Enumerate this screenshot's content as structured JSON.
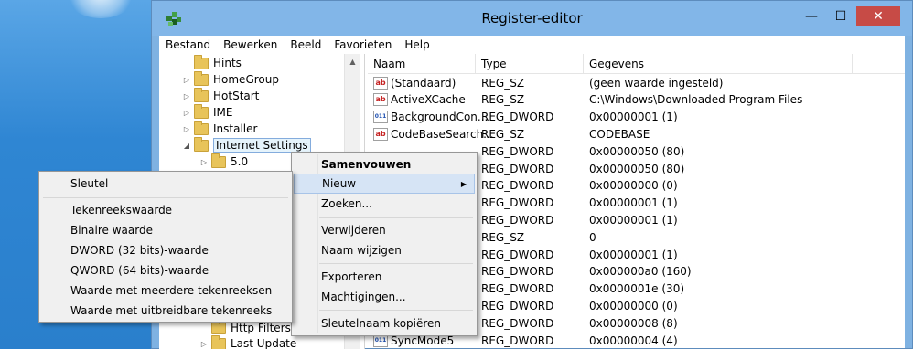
{
  "window": {
    "title": "Register-editor",
    "controls": {
      "minimize": "—",
      "maximize": "☐",
      "close": "✕"
    }
  },
  "menubar": [
    "Bestand",
    "Bewerken",
    "Beeld",
    "Favorieten",
    "Help"
  ],
  "tree": {
    "items": [
      {
        "label": "Hints",
        "expander": ""
      },
      {
        "label": "HomeGroup",
        "expander": "▷"
      },
      {
        "label": "HotStart",
        "expander": "▷"
      },
      {
        "label": "IME",
        "expander": "▷"
      },
      {
        "label": "Installer",
        "expander": "▷"
      },
      {
        "label": "Internet Settings",
        "expander": "◢",
        "selected": true
      },
      {
        "label": "5.0",
        "expander": "▷"
      },
      {
        "label": "Http Filters",
        "expander": ""
      },
      {
        "label": "Last Update",
        "expander": "▷"
      }
    ]
  },
  "list": {
    "columns": [
      "Naam",
      "Type",
      "Gegevens"
    ],
    "rows": [
      {
        "name": "(Standaard)",
        "type": "REG_SZ",
        "data": "(geen waarde ingesteld)",
        "icon": "string-value-icon"
      },
      {
        "name": "ActiveXCache",
        "type": "REG_SZ",
        "data": "C:\\Windows\\Downloaded Program Files",
        "icon": "string-value-icon"
      },
      {
        "name": "BackgroundCon...",
        "type": "REG_DWORD",
        "data": "0x00000001 (1)",
        "icon": "dword-value-icon"
      },
      {
        "name": "CodeBaseSearch...",
        "type": "REG_SZ",
        "data": "CODEBASE",
        "icon": "string-value-icon"
      },
      {
        "name": "",
        "type": "REG_DWORD",
        "data": "0x00000050 (80)",
        "icon": ""
      },
      {
        "name": "",
        "type": "REG_DWORD",
        "data": "0x00000050 (80)",
        "icon": ""
      },
      {
        "name": "",
        "type": "REG_DWORD",
        "data": "0x00000000 (0)",
        "icon": ""
      },
      {
        "name": "",
        "type": "REG_DWORD",
        "data": "0x00000001 (1)",
        "icon": ""
      },
      {
        "name": "",
        "type": "REG_DWORD",
        "data": "0x00000001 (1)",
        "icon": ""
      },
      {
        "name": "",
        "type": "REG_SZ",
        "data": "0",
        "icon": ""
      },
      {
        "name": "",
        "type": "REG_DWORD",
        "data": "0x00000001 (1)",
        "icon": ""
      },
      {
        "name": "",
        "type": "REG_DWORD",
        "data": "0x000000a0 (160)",
        "icon": ""
      },
      {
        "name": "",
        "type": "REG_DWORD",
        "data": "0x0000001e (30)",
        "icon": ""
      },
      {
        "name": "",
        "type": "REG_DWORD",
        "data": "0x00000000 (0)",
        "icon": ""
      },
      {
        "name": "",
        "type": "REG_DWORD",
        "data": "0x00000008 (8)",
        "icon": ""
      },
      {
        "name": "SyncMode5",
        "type": "REG_DWORD",
        "data": "0x00000004 (4)",
        "icon": "dword-value-icon"
      }
    ]
  },
  "context_menu": {
    "items": [
      "Samenvouwen",
      "Nieuw",
      "Zoeken...",
      "Verwijderen",
      "Naam wijzigen",
      "Exporteren",
      "Machtigingen...",
      "Sleutelnaam kopiëren"
    ]
  },
  "submenu": {
    "items": [
      "Sleutel",
      "Tekenreekswaarde",
      "Binaire waarde",
      "DWORD (32 bits)-waarde",
      "QWORD (64 bits)-waarde",
      "Waarde met meerdere tekenreeksen",
      "Waarde met uitbreidbare tekenreeks"
    ]
  }
}
